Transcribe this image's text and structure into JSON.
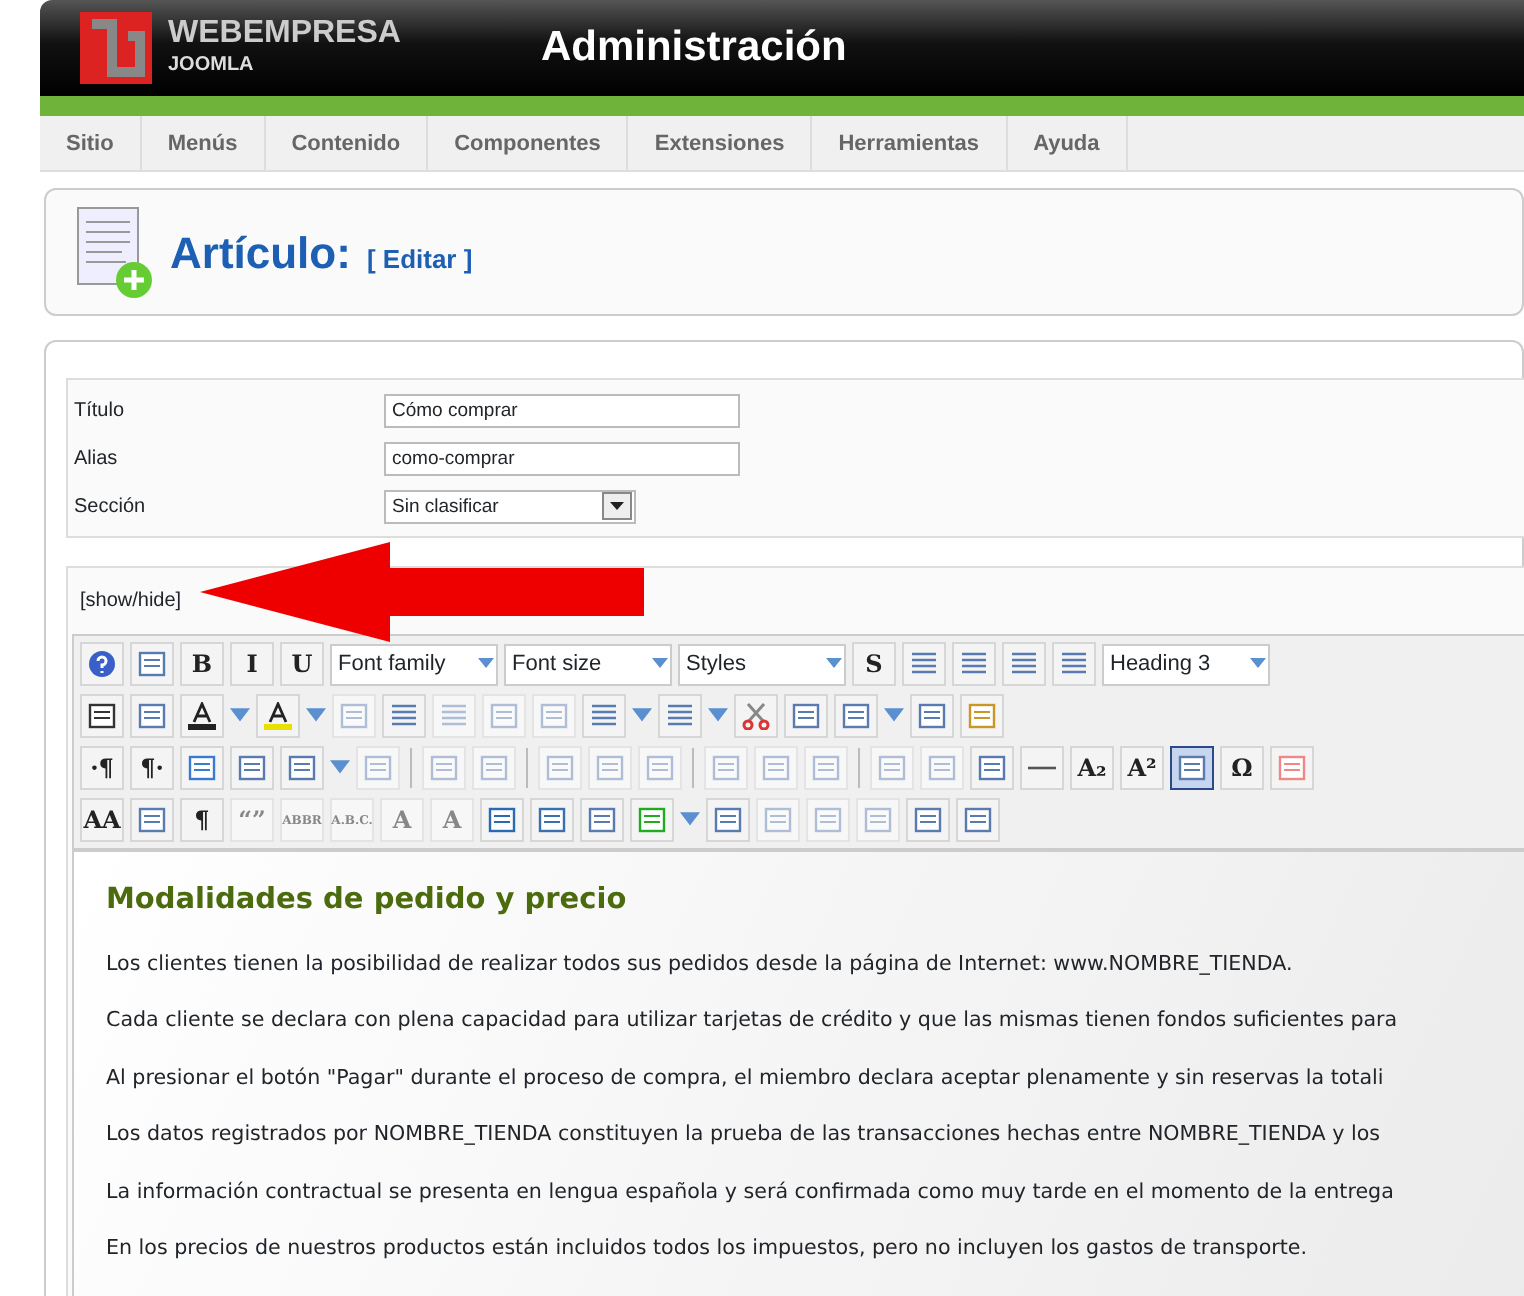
{
  "header": {
    "logo_name": "WEBEMPRESA",
    "logo_sub": "JOOMLA",
    "title": "Administración"
  },
  "menu": [
    {
      "label": "Sitio"
    },
    {
      "label": "Menús"
    },
    {
      "label": "Contenido"
    },
    {
      "label": "Componentes"
    },
    {
      "label": "Extensiones"
    },
    {
      "label": "Herramientas"
    },
    {
      "label": "Ayuda"
    }
  ],
  "page_title": {
    "title": "Artículo:",
    "action": "[ Editar ]"
  },
  "fields": [
    {
      "label": "Título",
      "kind": "text",
      "value": "Cómo comprar"
    },
    {
      "label": "Alias",
      "kind": "text",
      "value": "como-comprar"
    },
    {
      "label": "Sección",
      "kind": "select",
      "value": "Sin clasificar"
    }
  ],
  "toggle": "[show/hide]",
  "toolbar": [
    [
      {
        "kind": "icon",
        "disabled": false
      },
      {
        "kind": "icon",
        "disabled": false
      },
      {
        "kind": "glyph",
        "glyph": "B",
        "disabled": false
      },
      {
        "kind": "glyph",
        "glyph": "I",
        "disabled": false
      },
      {
        "kind": "glyph",
        "glyph": "U",
        "disabled": false
      },
      {
        "kind": "select",
        "value": "Font family"
      },
      {
        "kind": "select",
        "value": "Font size"
      },
      {
        "kind": "select",
        "value": "Styles"
      },
      {
        "kind": "glyph",
        "glyph": "S",
        "disabled": false
      },
      {
        "kind": "icon",
        "disabled": false
      },
      {
        "kind": "icon",
        "disabled": false
      },
      {
        "kind": "icon",
        "disabled": false
      },
      {
        "kind": "icon",
        "disabled": false
      },
      {
        "kind": "select",
        "value": "Heading 3"
      }
    ],
    [
      {
        "kind": "icon",
        "disabled": false
      },
      {
        "kind": "icon",
        "disabled": false
      },
      {
        "kind": "icon",
        "disabled": false,
        "dropdown": true
      },
      {
        "kind": "icon",
        "disabled": false,
        "dropdown": true
      },
      {
        "kind": "icon",
        "disabled": true
      },
      {
        "kind": "icon",
        "disabled": false
      },
      {
        "kind": "icon",
        "disabled": true
      },
      {
        "kind": "icon",
        "disabled": true
      },
      {
        "kind": "icon",
        "disabled": true
      },
      {
        "kind": "icon",
        "disabled": false,
        "dropdown": true
      },
      {
        "kind": "icon",
        "disabled": false,
        "dropdown": true
      },
      {
        "kind": "icon",
        "disabled": false
      },
      {
        "kind": "icon",
        "disabled": false
      },
      {
        "kind": "icon",
        "disabled": false,
        "dropdown": true
      },
      {
        "kind": "icon",
        "disabled": false
      },
      {
        "kind": "icon",
        "disabled": false
      }
    ],
    [
      {
        "kind": "glyph",
        "glyph": "·¶",
        "disabled": false
      },
      {
        "kind": "glyph",
        "glyph": "¶·",
        "disabled": false
      },
      {
        "kind": "icon",
        "disabled": false
      },
      {
        "kind": "icon",
        "disabled": false
      },
      {
        "kind": "icon",
        "disabled": false,
        "dropdown": true
      },
      {
        "kind": "icon",
        "disabled": true
      },
      {
        "kind": "separator"
      },
      {
        "kind": "icon",
        "disabled": true
      },
      {
        "kind": "icon",
        "disabled": true
      },
      {
        "kind": "separator"
      },
      {
        "kind": "icon",
        "disabled": true
      },
      {
        "kind": "icon",
        "disabled": true
      },
      {
        "kind": "icon",
        "disabled": true
      },
      {
        "kind": "separator"
      },
      {
        "kind": "icon",
        "disabled": true
      },
      {
        "kind": "icon",
        "disabled": true
      },
      {
        "kind": "icon",
        "disabled": true
      },
      {
        "kind": "separator"
      },
      {
        "kind": "icon",
        "disabled": true
      },
      {
        "kind": "icon",
        "disabled": true
      },
      {
        "kind": "icon",
        "disabled": false
      },
      {
        "kind": "icon",
        "disabled": false
      },
      {
        "kind": "glyph",
        "glyph": "A₂",
        "disabled": false
      },
      {
        "kind": "glyph",
        "glyph": "A²",
        "disabled": false
      },
      {
        "kind": "icon",
        "disabled": false,
        "selected": true
      },
      {
        "kind": "glyph",
        "glyph": "Ω",
        "disabled": false
      },
      {
        "kind": "icon",
        "disabled": false
      }
    ],
    [
      {
        "kind": "glyph",
        "glyph": "AA",
        "disabled": false
      },
      {
        "kind": "icon",
        "disabled": false
      },
      {
        "kind": "glyph",
        "glyph": "¶",
        "disabled": false
      },
      {
        "kind": "glyph",
        "glyph": "“”",
        "disabled": true
      },
      {
        "kind": "glyph",
        "glyph": "ABBR",
        "disabled": true
      },
      {
        "kind": "glyph",
        "glyph": "A.B.C.",
        "disabled": true
      },
      {
        "kind": "glyph",
        "glyph": "A",
        "disabled": true
      },
      {
        "kind": "glyph",
        "glyph": "A",
        "disabled": true
      },
      {
        "kind": "icon",
        "disabled": false
      },
      {
        "kind": "icon",
        "disabled": false
      },
      {
        "kind": "icon",
        "disabled": false
      },
      {
        "kind": "icon",
        "disabled": false,
        "dropdown": true
      },
      {
        "kind": "icon",
        "disabled": false
      },
      {
        "kind": "icon",
        "disabled": true
      },
      {
        "kind": "icon",
        "disabled": true
      },
      {
        "kind": "icon",
        "disabled": true
      },
      {
        "kind": "icon",
        "disabled": false
      },
      {
        "kind": "icon",
        "disabled": false
      }
    ]
  ],
  "content": {
    "heading": "Modalidades de pedido y precio",
    "paragraphs": [
      "Los clientes tienen la posibilidad de realizar todos sus pedidos desde la página de Internet: www.NOMBRE_TIENDA.",
      "Cada cliente se declara con plena capacidad para utilizar tarjetas de crédito y que las mismas tienen fondos suficientes para",
      "Al presionar el botón \"Pagar\" durante el proceso de compra, el miembro declara aceptar plenamente y sin reservas la totali",
      "Los datos registrados por NOMBRE_TIENDA constituyen la prueba de las transacciones hechas entre NOMBRE_TIENDA y los",
      "La información contractual se presenta en lengua española y será confirmada como muy tarde en el momento de la entrega",
      "En los precios de nuestros productos están incluidos todos los impuestos, pero no incluyen los gastos de transporte."
    ]
  }
}
